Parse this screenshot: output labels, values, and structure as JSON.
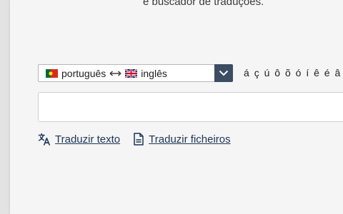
{
  "header": {
    "subtitle": "e buscador de traduções."
  },
  "language_selector": {
    "source_flag_icon": "portugal-flag-icon",
    "source_language": "português",
    "direction_icon": "left-right-arrow-icon",
    "target_flag_icon": "uk-flag-icon",
    "target_language": "inglês",
    "dropdown_icon": "chevron-down-icon",
    "button_color": "#3b4c63"
  },
  "special_characters": [
    "á",
    "ç",
    "ú",
    "ô",
    "õ",
    "ó",
    "í",
    "ê",
    "é",
    "â"
  ],
  "search": {
    "value": "",
    "placeholder": ""
  },
  "links": {
    "translate_text": {
      "icon": "translate-icon",
      "label": "Traduzir texto"
    },
    "translate_files": {
      "icon": "document-icon",
      "label": "Traduzir ficheiros"
    }
  }
}
